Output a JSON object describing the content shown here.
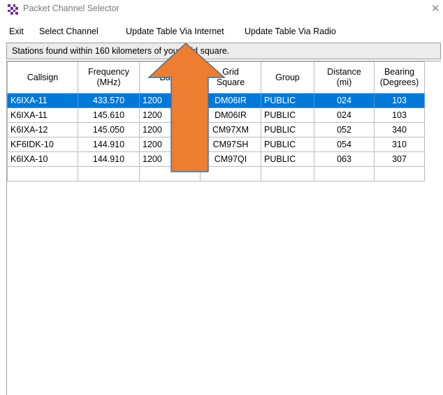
{
  "window": {
    "title": "Packet Channel Selector",
    "close_glyph": "✕",
    "icon": "checkered-app-icon",
    "icon_colors": [
      "#7030a0",
      "#ffffff"
    ]
  },
  "menu": {
    "items": [
      {
        "label": "Exit"
      },
      {
        "label": "Select Channel"
      },
      {
        "label": "Update Table Via Internet"
      },
      {
        "label": "Update Table Via Radio"
      }
    ]
  },
  "status": {
    "text": "Stations found within 160 kilometers of your grid square."
  },
  "table": {
    "columns": [
      "Callsign",
      "Frequency\n(MHz)",
      "Baud",
      "Grid\nSquare",
      "Group",
      "Distance\n(mi)",
      "Bearing\n(Degrees)"
    ],
    "rows": [
      [
        "K6IXA-11",
        "433.570",
        "1200",
        "DM06IR",
        "PUBLIC",
        "024",
        "103"
      ],
      [
        "K6IXA-11",
        "145.610",
        "1200",
        "DM06IR",
        "PUBLIC",
        "024",
        "103"
      ],
      [
        "K6IXA-12",
        "145.050",
        "1200",
        "CM97XM",
        "PUBLIC",
        "052",
        "340"
      ],
      [
        "KF6IDK-10",
        "144.910",
        "1200",
        "CM97SH",
        "PUBLIC",
        "054",
        "310"
      ],
      [
        "K6IXA-10",
        "144.910",
        "1200",
        "CM97QI",
        "PUBLIC",
        "063",
        "307"
      ],
      [
        "",
        "",
        "",
        "",
        "",
        "",
        ""
      ]
    ],
    "selected_row": 0
  },
  "annotation": {
    "arrow_direction": "up",
    "arrow_color": "#ed7d31",
    "arrow_outline": "#41719c"
  },
  "colors": {
    "selection": "#0078d7",
    "status_bg": "#ececec"
  }
}
